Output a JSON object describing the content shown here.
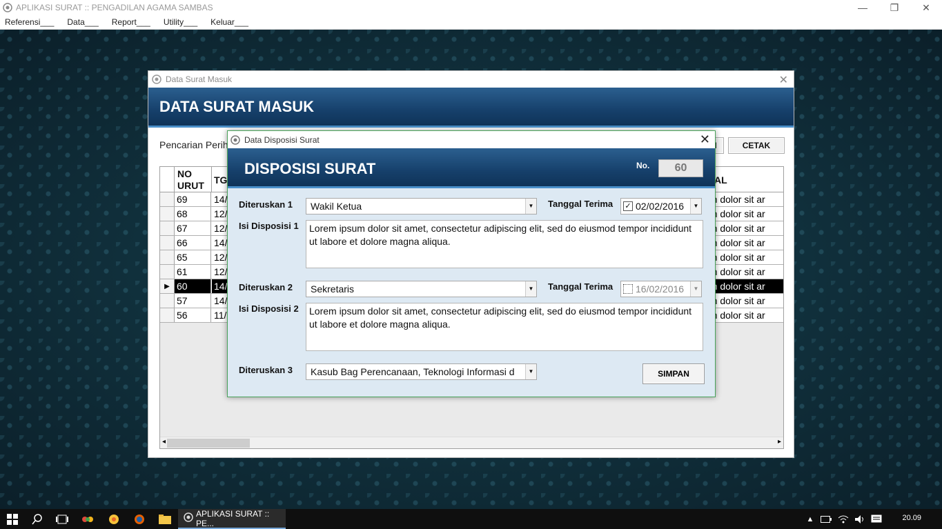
{
  "app": {
    "title": "APLIKASI SURAT :: PENGADILAN AGAMA SAMBAS",
    "window_controls": [
      "—",
      "❐",
      "✕"
    ]
  },
  "menu": [
    "Referensi___",
    "Data___",
    "Report___",
    "Utility___",
    "Keluar___"
  ],
  "masuk": {
    "window_title": "Data Surat Masuk",
    "banner": "DATA SURAT MASUK",
    "search_label": "Pencarian Perih",
    "cetak_button": "CETAK",
    "partial_button": "I",
    "columns": {
      "no_urut_1": "NO",
      "no_urut_2": "URUT",
      "tgl": "TG",
      "isi": "AL"
    },
    "rows": [
      {
        "no": "69",
        "tgl": "14/",
        "isi": "sum dolor sit ar"
      },
      {
        "no": "68",
        "tgl": "12/",
        "isi": "sum dolor sit ar"
      },
      {
        "no": "67",
        "tgl": "12/",
        "isi": "sum dolor sit ar"
      },
      {
        "no": "66",
        "tgl": "14/",
        "isi": "sum dolor sit ar"
      },
      {
        "no": "65",
        "tgl": "12/",
        "isi": "sum dolor sit ar"
      },
      {
        "no": "61",
        "tgl": "12/",
        "isi": "sum dolor sit ar"
      },
      {
        "no": "60",
        "tgl": "14/",
        "isi": "sum dolor sit ar"
      },
      {
        "no": "57",
        "tgl": "14/",
        "isi": "sum dolor sit ar"
      },
      {
        "no": "56",
        "tgl": "11/",
        "isi": "sum dolor sit ar"
      }
    ],
    "active_row_index": 6
  },
  "disposisi": {
    "window_title": "Data Disposisi Surat",
    "banner": "DISPOSISI SURAT",
    "no_label": "No.",
    "no_value": "60",
    "diteruskan1_label": "Diteruskan 1",
    "diteruskan1_value": "Wakil Ketua",
    "tanggal1_label": "Tanggal Terima",
    "tanggal1_checked": "✓",
    "tanggal1_value": "02/02/2016",
    "isi1_label": "Isi Disposisi 1",
    "isi1_value": "Lorem ipsum dolor sit amet, consectetur adipiscing elit, sed do eiusmod tempor incididunt ut labore et dolore magna aliqua.",
    "diteruskan2_label": "Diteruskan 2",
    "diteruskan2_value": "Sekretaris",
    "tanggal2_label": "Tanggal Terima",
    "tanggal2_value": "16/02/2016",
    "isi2_label": "Isi Disposisi 2",
    "isi2_value": "Lorem ipsum dolor sit amet, consectetur adipiscing elit, sed do eiusmod tempor incididunt ut labore et dolore magna aliqua.",
    "diteruskan3_label": "Diteruskan 3",
    "diteruskan3_value": "Kasub Bag Perencanaan, Teknologi Informasi d",
    "simpan_button": "SIMPAN"
  },
  "taskbar": {
    "app_label": "APLIKASI SURAT :: PE...",
    "clock": "20.09"
  }
}
